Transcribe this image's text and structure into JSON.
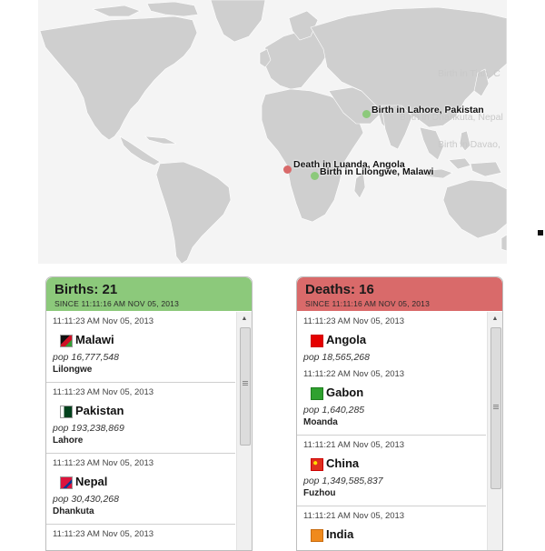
{
  "map": {
    "markers": [
      {
        "label": "Birth in Lahore, Pakistan",
        "color": "#8cc97b",
        "faded": false
      },
      {
        "label": "Birth in Dhankuta, Nepal",
        "color": "#8cc97b",
        "faded": true
      },
      {
        "label": "Birth in Davao,",
        "color": "#8cc97b",
        "faded": true
      },
      {
        "label": "Birth in Tian, C",
        "color": "#8cc97b",
        "faded": true
      },
      {
        "label": "Death in Luanda, Angola",
        "color": "#d96a6a",
        "faded": false
      },
      {
        "label": "Birth in Lilongwe, Malawi",
        "color": "#8cc97b",
        "faded": false
      }
    ]
  },
  "births": {
    "title": "Births: 21",
    "since": "SINCE 11:11:16 AM NOV 05, 2013",
    "entries": [
      {
        "time": "11:11:23 AM Nov 05, 2013",
        "country": "Malawi",
        "pop": "pop 16,777,548",
        "city": "Lilongwe",
        "flag_icon": "malawi-flag-icon"
      },
      {
        "time": "11:11:23 AM Nov 05, 2013",
        "country": "Pakistan",
        "pop": "pop 193,238,869",
        "city": "Lahore",
        "flag_icon": "pakistan-flag-icon"
      },
      {
        "time": "11:11:23 AM Nov 05, 2013",
        "country": "Nepal",
        "pop": "pop 30,430,268",
        "city": "Dhankuta",
        "flag_icon": "nepal-flag-icon"
      },
      {
        "time": "11:11:23 AM Nov 05, 2013",
        "country": "",
        "pop": "",
        "city": "",
        "flag_icon": ""
      }
    ]
  },
  "deaths": {
    "title": "Deaths: 16",
    "since": "SINCE 11:11:16 AM NOV 05, 2013",
    "entries": [
      {
        "time": "11:11:23 AM Nov 05, 2013",
        "country": "Angola",
        "pop": "pop 18,565,268",
        "city": "",
        "flag_icon": "angola-flag-icon"
      },
      {
        "time": "11:11:22 AM Nov 05, 2013",
        "country": "Gabon",
        "pop": "pop 1,640,285",
        "city": "Moanda",
        "flag_icon": "gabon-flag-icon"
      },
      {
        "time": "11:11:21 AM Nov 05, 2013",
        "country": "China",
        "pop": "pop 1,349,585,837",
        "city": "Fuzhou",
        "flag_icon": "china-flag-icon"
      },
      {
        "time": "11:11:21 AM Nov 05, 2013",
        "country": "India",
        "pop": "",
        "city": "",
        "flag_icon": "india-flag-icon"
      }
    ]
  },
  "colors": {
    "births": "#8cc97b",
    "deaths": "#d96a6a"
  }
}
